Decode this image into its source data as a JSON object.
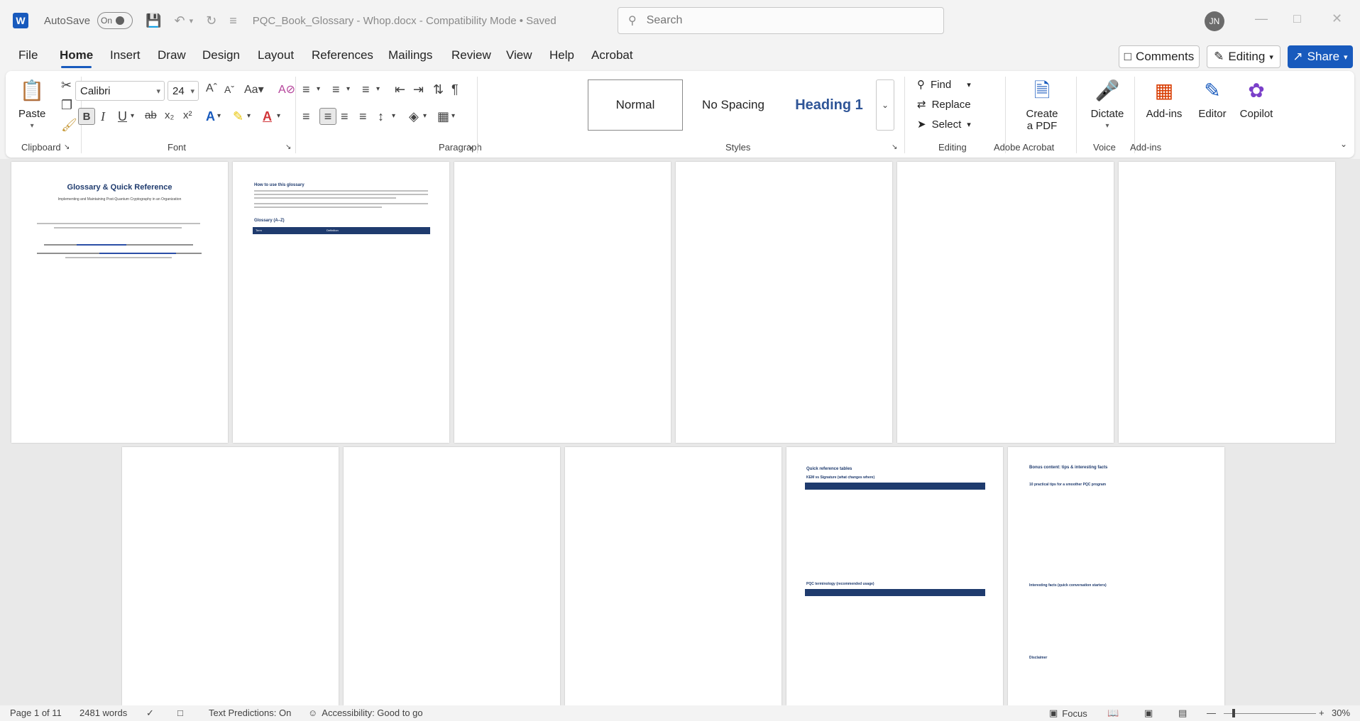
{
  "titlebar": {
    "app_letter": "W",
    "autosave_label": "AutoSave",
    "autosave_state": "On",
    "doc_title": "PQC_Book_Glossary - Whop.docx",
    "mode": "Compatibility Mode",
    "save_status": "Saved",
    "search_placeholder": "Search",
    "user_initials": "JN"
  },
  "tabs": [
    "File",
    "Home",
    "Insert",
    "Draw",
    "Design",
    "Layout",
    "References",
    "Mailings",
    "Review",
    "View",
    "Help",
    "Acrobat"
  ],
  "active_tab": "Home",
  "actions": {
    "comments": "Comments",
    "editing": "Editing",
    "share": "Share"
  },
  "ribbon": {
    "clipboard": {
      "label": "Clipboard",
      "paste": "Paste"
    },
    "font": {
      "label": "Font",
      "name": "Calibri",
      "size": "24"
    },
    "paragraph": {
      "label": "Paragraph"
    },
    "styles": {
      "label": "Styles",
      "items": [
        "Normal",
        "No Spacing",
        "Heading 1"
      ]
    },
    "editing": {
      "label": "Editing",
      "find": "Find",
      "replace": "Replace",
      "select": "Select"
    },
    "adobe": {
      "label": "Adobe Acrobat",
      "create_pdf_line1": "Create",
      "create_pdf_line2": "a PDF"
    },
    "voice": {
      "label": "Voice",
      "dictate": "Dictate"
    },
    "addins": {
      "label": "Add-ins",
      "addins": "Add-ins",
      "editor": "Editor",
      "copilot": "Copilot"
    }
  },
  "pages": {
    "p1": {
      "title": "Glossary & Quick Reference",
      "subtitle": "Implementing and Maintaining Post-Quantum Cryptography in an Organization"
    },
    "p2": {
      "heading": "How to use this glossary",
      "subheading": "Glossary (A–Z)",
      "col_term": "Term",
      "col_def": "Definition"
    },
    "p10": {
      "heading": "Quick reference tables",
      "sub1": "KEM vs Signature (what changes where)",
      "sub2": "PQC terminology (recommended usage)"
    },
    "p11": {
      "heading": "Bonus content: tips & interesting facts",
      "sub1": "10 practical tips for a smoother PQC program",
      "sub2": "Interesting facts (quick conversation starters)",
      "sub3": "Disclaimer"
    }
  },
  "statusbar": {
    "page": "Page 1 of 11",
    "words": "2481 words",
    "predictions": "Text Predictions: On",
    "accessibility": "Accessibility: Good to go",
    "focus": "Focus",
    "zoom": "30%"
  },
  "colors": {
    "accent": "#185abd",
    "table_header": "#1f3b6e"
  }
}
